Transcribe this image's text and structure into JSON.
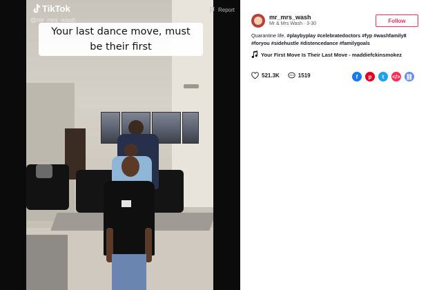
{
  "video": {
    "brand": "TikTok",
    "handle": "@mr_mrs_wash",
    "report_label": "Report",
    "caption_line1": "Your last dance move, must",
    "caption_line2": "be their first"
  },
  "profile": {
    "username": "mr_mrs_wash",
    "subline": "Mr & Mrs Wash · 3-30",
    "follow_label": "Follow",
    "description_text": "Quarantine life. ",
    "description_tags": "#playbyplay #celebratedoctors #fyp #washfamily8 #foryou #sidehustle #distencedance #familygoals",
    "music": "Your First Move Is Their Last Move - maddiefckinsmokez"
  },
  "stats": {
    "likes": "521.3K",
    "comments": "1519"
  },
  "share_icons": [
    "facebook-icon",
    "pinterest-icon",
    "twitter-icon",
    "embed-icon",
    "link-icon"
  ],
  "colors": {
    "follow": "#fe2c55",
    "fb": "#1877f2",
    "pin": "#e60023",
    "tw": "#1da1f2",
    "embed": "#fe2c55",
    "link": "#6c8cf5"
  }
}
